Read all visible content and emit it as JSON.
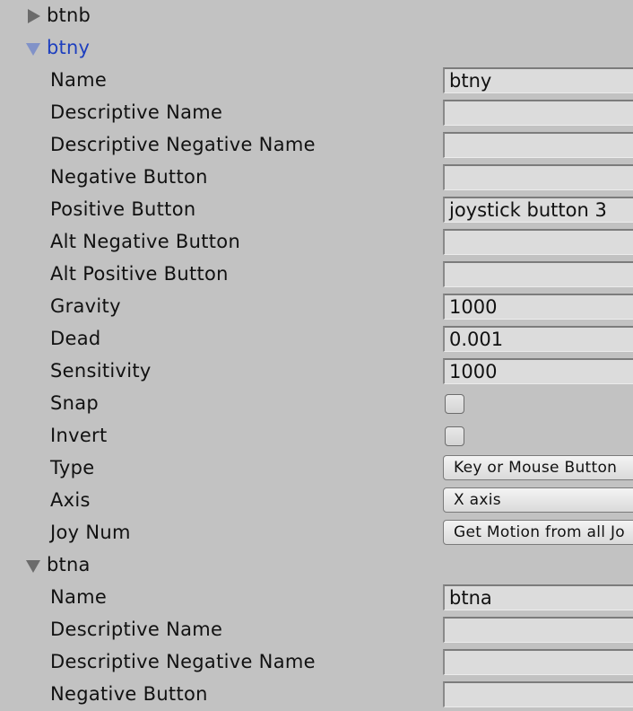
{
  "axes": [
    {
      "name": "btnb",
      "expanded": false
    },
    {
      "name": "btny",
      "expanded": true,
      "properties": {
        "name_label": "Name",
        "name_value": "btny",
        "descriptive_name_label": "Descriptive Name",
        "descriptive_name_value": "",
        "descriptive_negative_name_label": "Descriptive Negative Name",
        "descriptive_negative_name_value": "",
        "negative_button_label": "Negative Button",
        "negative_button_value": "",
        "positive_button_label": "Positive Button",
        "positive_button_value": "joystick button 3",
        "alt_negative_button_label": "Alt Negative Button",
        "alt_negative_button_value": "",
        "alt_positive_button_label": "Alt Positive Button",
        "alt_positive_button_value": "",
        "gravity_label": "Gravity",
        "gravity_value": "1000",
        "dead_label": "Dead",
        "dead_value": "0.001",
        "sensitivity_label": "Sensitivity",
        "sensitivity_value": "1000",
        "snap_label": "Snap",
        "snap_checked": false,
        "invert_label": "Invert",
        "invert_checked": false,
        "type_label": "Type",
        "type_value": "Key or Mouse Button",
        "axis_label": "Axis",
        "axis_value": "X axis",
        "joy_num_label": "Joy Num",
        "joy_num_value": "Get Motion from all Jo"
      }
    },
    {
      "name": "btna",
      "expanded": true,
      "properties": {
        "name_label": "Name",
        "name_value": "btna",
        "descriptive_name_label": "Descriptive Name",
        "descriptive_name_value": "",
        "descriptive_negative_name_label": "Descriptive Negative Name",
        "descriptive_negative_name_value": "",
        "negative_button_label": "Negative Button",
        "negative_button_value": ""
      }
    }
  ],
  "colors": {
    "background": "#c2c2c2",
    "field_background": "#dcdcdc",
    "active_foldout_text": "#1d3fbf",
    "active_foldout_arrow": "#8192c8",
    "arrow": "#6b6b6b"
  }
}
